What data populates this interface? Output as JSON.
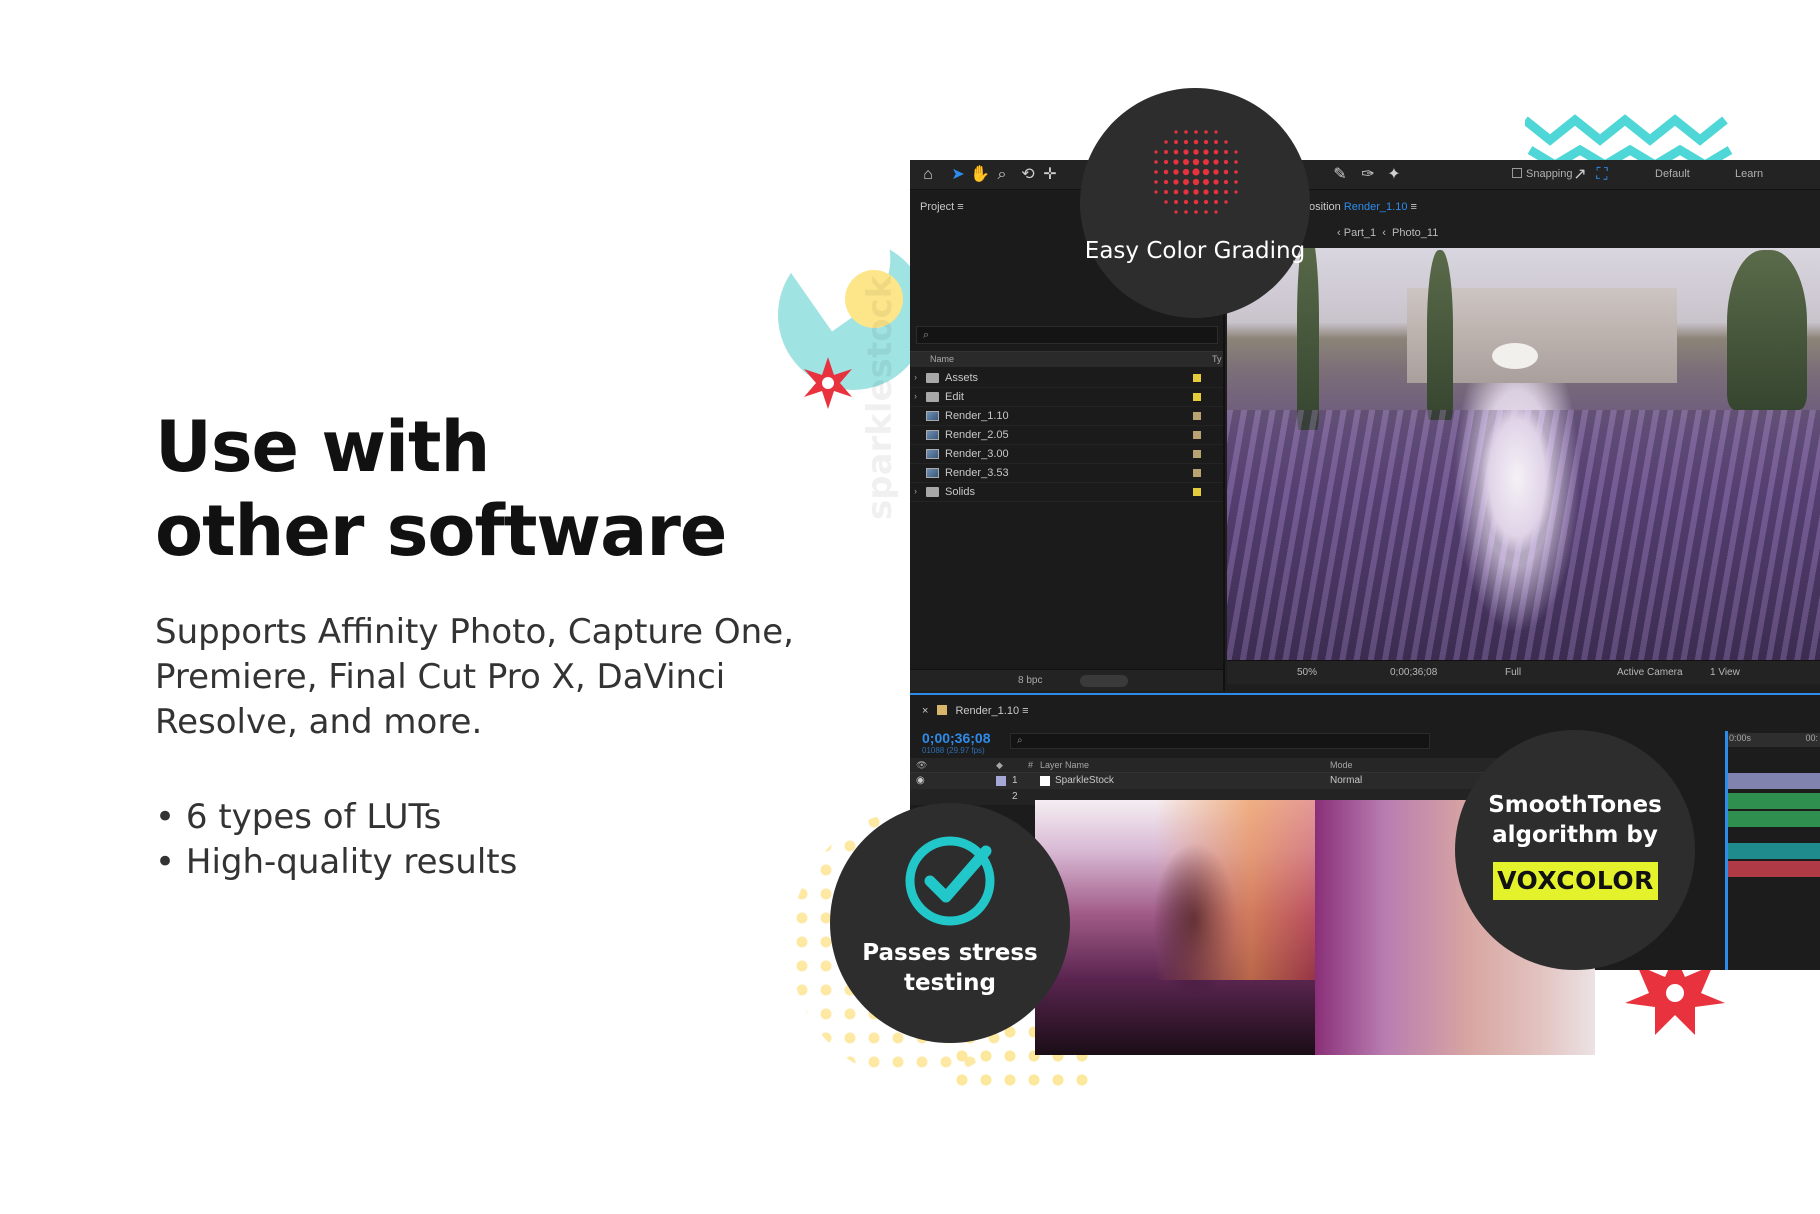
{
  "hero": {
    "title_line1": "Use with",
    "title_line2": "other software",
    "description": "Supports Affinity Photo, Capture One, Premiere, Final Cut Pro X, DaVinci Resolve, and more.",
    "bullets": [
      "6 types of LUTs",
      "High-quality results"
    ]
  },
  "badges": {
    "top": "Easy Color Grading",
    "bottom_left": "Passes stress testing",
    "bottom_right": "SmoothTones algorithm by",
    "brand": "VOXCOLOR"
  },
  "watermark": "sparklestock",
  "app": {
    "toolbar": {
      "snapping_label": "Snapping",
      "workspace_default": "Default",
      "workspace_learn": "Learn"
    },
    "project": {
      "title": "Project",
      "search_placeholder": "⌕",
      "col_name": "Name",
      "col_type": "Ty",
      "items": [
        {
          "label": "Assets",
          "type": "folder",
          "tag": "#e4cc3c"
        },
        {
          "label": "Edit",
          "type": "folder",
          "tag": "#e4cc3c"
        },
        {
          "label": "Render_1.10",
          "type": "comp",
          "tag": "#b9a373"
        },
        {
          "label": "Render_2.05",
          "type": "comp",
          "tag": "#b9a373"
        },
        {
          "label": "Render_3.00",
          "type": "comp",
          "tag": "#b9a373"
        },
        {
          "label": "Render_3.53",
          "type": "comp",
          "tag": "#b9a373"
        },
        {
          "label": "Solids",
          "type": "folder",
          "tag": "#e4cc3c"
        }
      ],
      "bpc": "8 bpc"
    },
    "composition": {
      "title_prefix": "osition",
      "title_name": "Render_1.10",
      "crumb1": "Part_1",
      "crumb2": "Photo_11"
    },
    "viewer_footer": {
      "zoom": "50%",
      "timecode": "0;00;36;08",
      "resolution": "Full",
      "camera": "Active Camera",
      "views": "1 View"
    },
    "timeline": {
      "tab": "Render_1.10",
      "timecode": "0;00;36;08",
      "fps": "01088 (29.97 fps)",
      "col_layer_name": "Layer Name",
      "col_mode": "Mode",
      "layer_index": "1",
      "layer_name": "SparkleStock",
      "layer_mode": "Normal",
      "layer2_index": "2",
      "ruler_start": "0:00s",
      "ruler_end": "00:"
    }
  },
  "colors": {
    "accent_blue": "#2d8ceb",
    "badge_bg": "#2d2d2d",
    "brand_yellow": "#e4f22c",
    "check_cyan": "#22c7c9",
    "dot_red": "#e8333f",
    "wave_cyan": "#4fd6d6",
    "star_red": "#e8333f"
  }
}
